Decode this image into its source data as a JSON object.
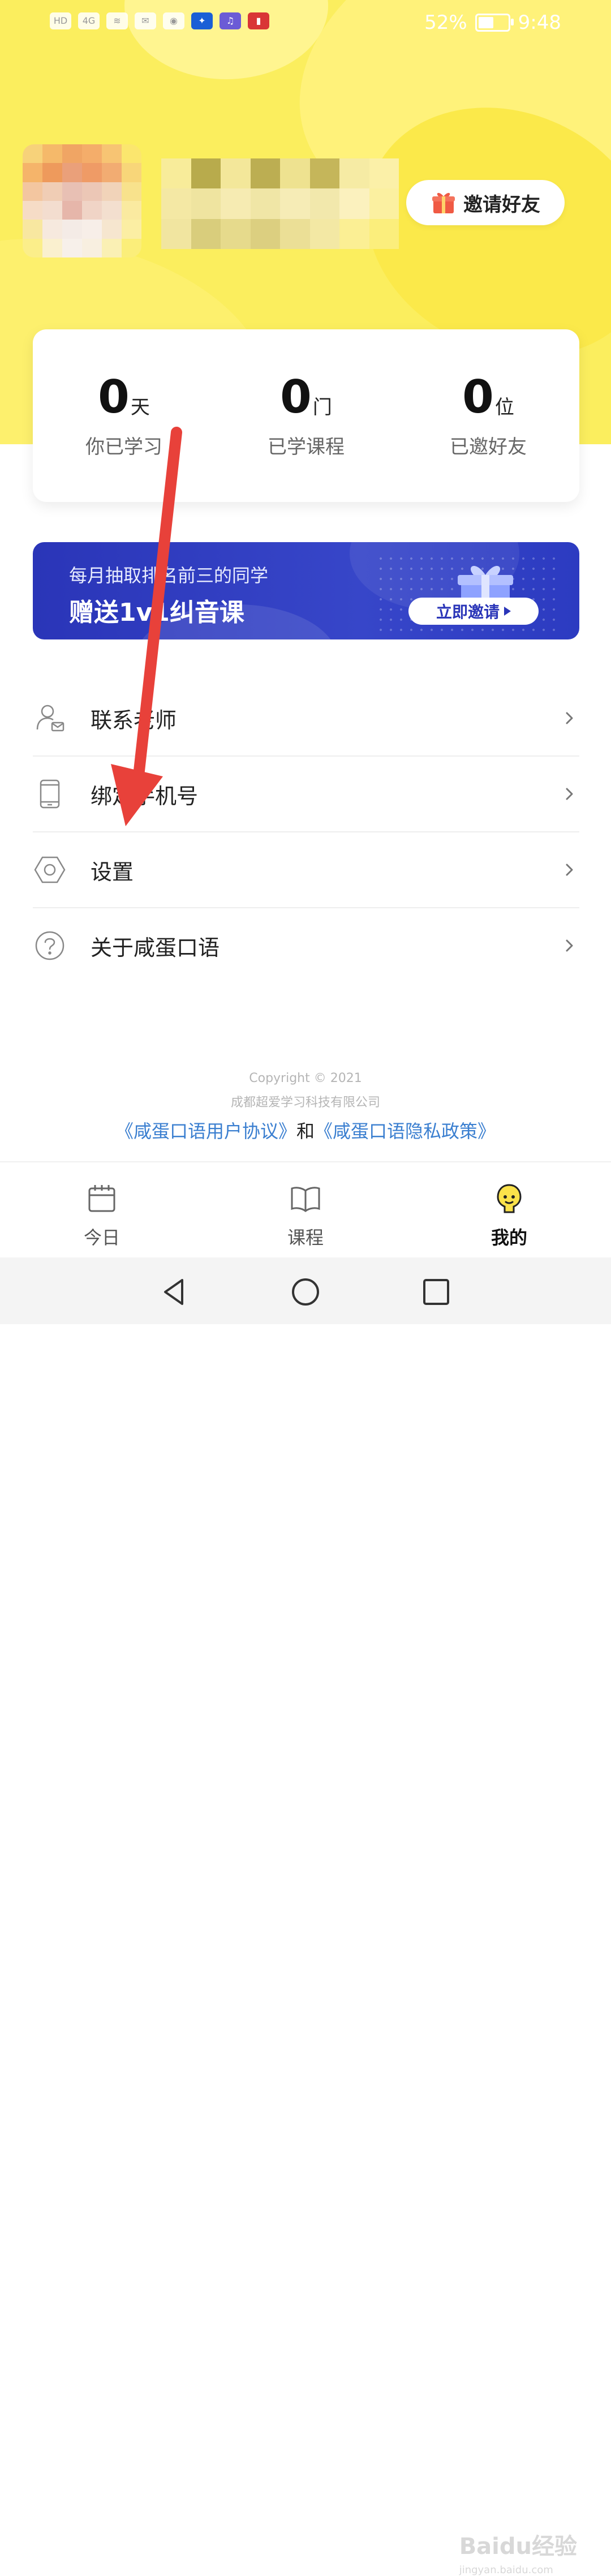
{
  "status_bar": {
    "left_icons": [
      "HD",
      "4G",
      "wifi",
      "mail",
      "app",
      "bulb",
      "music",
      "book"
    ],
    "battery": "52%",
    "time": "9:48"
  },
  "header": {
    "invite_button": "邀请好友"
  },
  "stats": [
    {
      "value": "0",
      "unit": "天",
      "label": "你已学习"
    },
    {
      "value": "0",
      "unit": "门",
      "label": "已学课程"
    },
    {
      "value": "0",
      "unit": "位",
      "label": "已邀好友"
    }
  ],
  "banner": {
    "line1": "每月抽取排名前三的同学",
    "line2": "赠送1v1纠音课",
    "button": "立即邀请"
  },
  "menu": [
    {
      "label": "联系老师",
      "icon": "teacher-contact-icon"
    },
    {
      "label": "绑定手机号",
      "icon": "phone-icon"
    },
    {
      "label": "设置",
      "icon": "settings-hexagon-icon"
    },
    {
      "label": "关于咸蛋口语",
      "icon": "help-circle-icon"
    }
  ],
  "footer": {
    "copyright": "Copyright © 2021",
    "company": "成都超爱学习科技有限公司",
    "user_agreement": "《咸蛋口语用户协议》",
    "and": "和",
    "privacy_policy": "《咸蛋口语隐私政策》"
  },
  "tabs": [
    {
      "label": "今日",
      "icon": "calendar-icon",
      "active": false
    },
    {
      "label": "课程",
      "icon": "open-book-icon",
      "active": false
    },
    {
      "label": "我的",
      "icon": "mascot-profile-icon",
      "active": true
    }
  ],
  "watermark": {
    "brand": "Baidu经验",
    "site": "jingyan.baidu.com"
  },
  "colors": {
    "accent_yellow": "#fbee5e",
    "banner_blue": "#2a35b8",
    "link_blue": "#3b7fd0",
    "annotation_red": "#e8413a"
  }
}
